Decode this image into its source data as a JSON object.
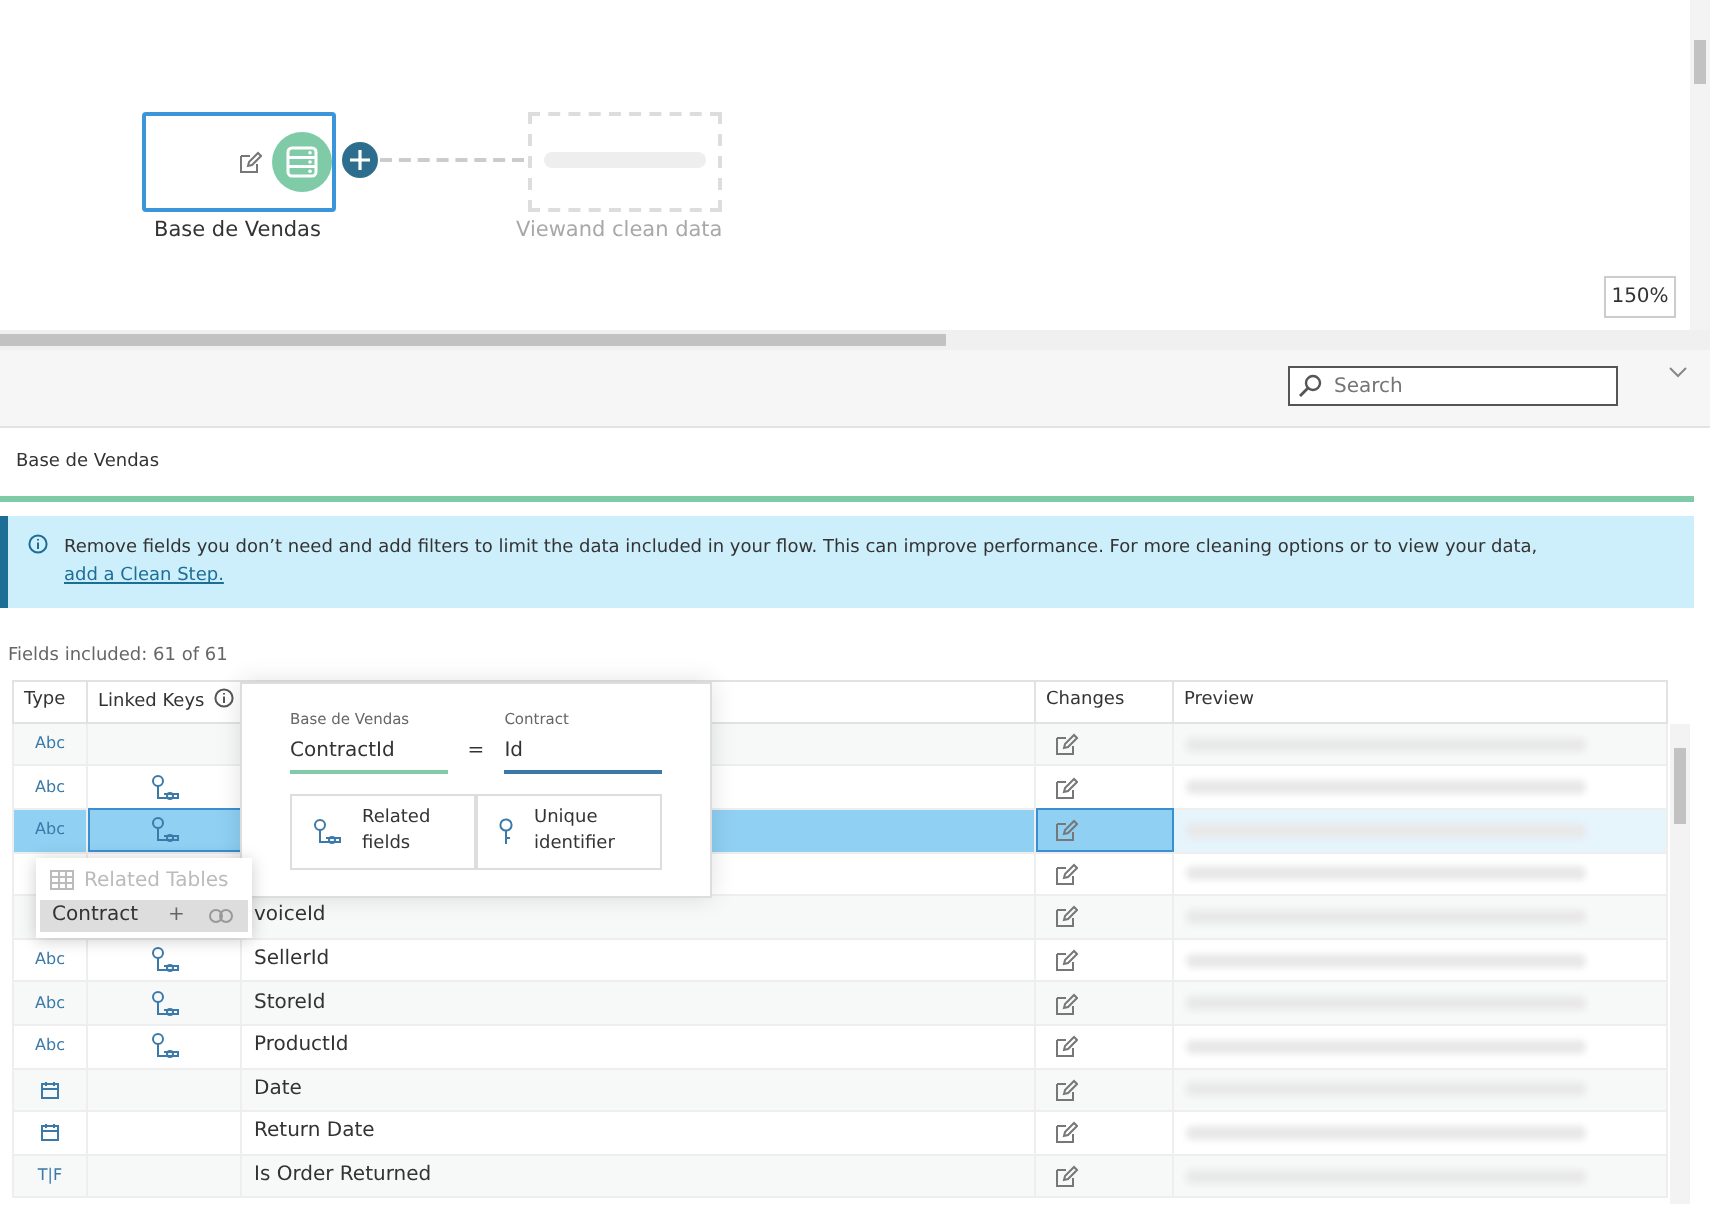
{
  "flow": {
    "nodes": [
      {
        "kind": "input",
        "label": "Base de Vendas",
        "selected": true
      },
      {
        "kind": "placeholder",
        "label": "Viewand clean data"
      }
    ],
    "zoom": "150%"
  },
  "search": {
    "placeholder": "Search"
  },
  "step_title": "Base de Vendas",
  "info": {
    "text": "Remove fields you don’t need and add filters to limit the data included in your flow. This can improve performance. For more cleaning options or to view your data, ",
    "link": "add a Clean Step."
  },
  "fields_included": "Fields included: 61 of 61",
  "table": {
    "columns": [
      "Type",
      "Linked Keys",
      "Changes",
      "Preview"
    ],
    "rows": [
      {
        "kind": "string",
        "type_label": "Abc",
        "linked_key": false,
        "selected": false,
        "preview_blurred": true
      },
      {
        "kind": "string",
        "type_label": "Abc",
        "linked_key": true,
        "selected": false,
        "preview_blurred": true
      },
      {
        "kind": "string",
        "type_label": "Abc",
        "linked_key": true,
        "selected": true,
        "preview_blurred": true
      },
      {
        "selected": false,
        "preview_blurred": true
      },
      {
        "field": "voiceId",
        "selected": false,
        "preview_blurred": true
      },
      {
        "kind": "string",
        "type_label": "Abc",
        "linked_key": true,
        "field": "SellerId",
        "selected": false,
        "preview_blurred": true
      },
      {
        "kind": "string",
        "type_label": "Abc",
        "linked_key": true,
        "field": "StoreId",
        "selected": false,
        "preview_blurred": true
      },
      {
        "kind": "string",
        "type_label": "Abc",
        "linked_key": true,
        "field": "ProductId",
        "selected": false,
        "preview_blurred": true
      },
      {
        "kind": "date",
        "linked_key": false,
        "field": "Date",
        "selected": false,
        "preview_blurred": true
      },
      {
        "kind": "date",
        "linked_key": false,
        "field": "Return Date",
        "selected": false,
        "preview_blurred": true
      },
      {
        "kind": "boolean",
        "type_label": "T|F",
        "linked_key": false,
        "field": "Is Order Returned",
        "selected": false,
        "preview_blurred": true
      }
    ]
  },
  "key_popover": {
    "left_table": "Base de Vendas",
    "left_field": "ContractId",
    "operator": "=",
    "right_table": "Contract",
    "right_field": "Id",
    "steps": [
      "Related fields",
      "Unique identifier"
    ]
  },
  "related_tables": {
    "title": "Related Tables",
    "items": [
      {
        "name": "Contract",
        "action": "+"
      }
    ]
  }
}
